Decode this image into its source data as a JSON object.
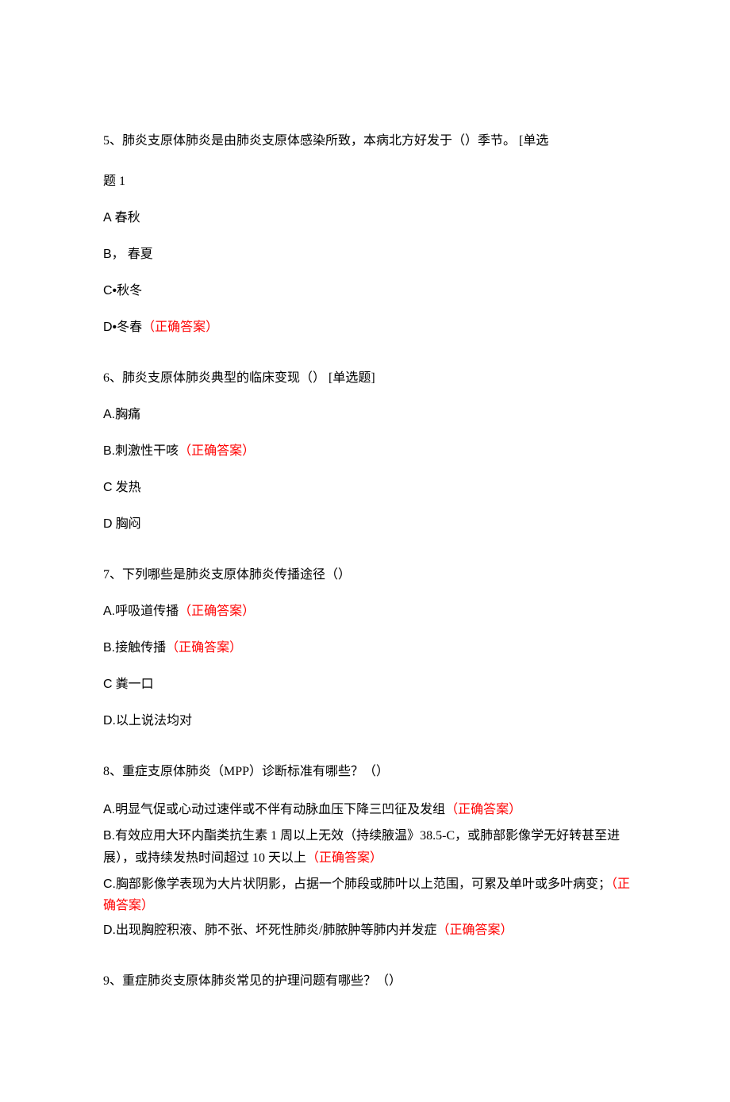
{
  "questions": [
    {
      "stem_a": "5、肺炎支原体肺炎是由肺炎支原体感染所致，本病北方好发于（）季节。 [单选",
      "stem_b": "题 1",
      "options": [
        {
          "label_prefix": "A",
          "text": "春秋",
          "correct": false
        },
        {
          "label_prefix": "B，",
          "text": "春夏",
          "correct": false
        },
        {
          "label_prefix": "C•",
          "text": "秋冬",
          "correct": false
        },
        {
          "label_prefix": "D•",
          "text": "冬春",
          "correct": true,
          "correct_label": "（正确答案）"
        }
      ]
    },
    {
      "stem_a": "6、肺炎支原体肺炎典型的临床变现（） [单选题]",
      "options": [
        {
          "label_prefix": "A.",
          "text": "胸痛",
          "correct": false
        },
        {
          "label_prefix": "B.",
          "text": "刺激性干咳",
          "correct": true,
          "correct_label": "（正确答案）"
        },
        {
          "label_prefix": "C",
          "text": "发热",
          "correct": false
        },
        {
          "label_prefix": "D",
          "text": "胸闷",
          "correct": false
        }
      ]
    },
    {
      "stem_a": "7、下列哪些是肺炎支原体肺炎传播途径（）",
      "options": [
        {
          "label_prefix": "A.",
          "text": "呼吸道传播",
          "correct": true,
          "correct_label_pre": "（正确",
          "correct_label_post": "答案）"
        },
        {
          "label_prefix": "B.",
          "text": "接触传播",
          "correct": true,
          "correct_label_pre": "（正确",
          "correct_label_post": "答案）"
        },
        {
          "label_prefix": "C",
          "text": "粪一口",
          "correct": false
        },
        {
          "label_prefix": "D.",
          "text": "以上说法均对",
          "correct": false
        }
      ]
    },
    {
      "stem_a": "8、重症支原体肺炎（MPP）诊断标准有哪些？（）",
      "options_tight": true,
      "options": [
        {
          "label_prefix": "A.",
          "text": "明显气促或心动过速伴或不伴有动脉血压下降三凹征及发组",
          "correct": true,
          "correct_label": "（正确答案）"
        },
        {
          "label_prefix": "B.",
          "text_a": "有效应用大环内酯类抗生素 1 周以上无效（持续腋温》38.5-C，或肺部影像学无好转甚至进展），或持续发热时间超过 10 天以上",
          "correct": true,
          "correct_label_pre": "（正确",
          "correct_label_post": "答案）"
        },
        {
          "label_prefix": "C.",
          "text_a": "胸部影像学表现为大片状阴影，占据一个肺段或肺叶以上范围，可累及单叶或多叶病变；",
          "correct": true,
          "correct_label": "（正确答案）"
        },
        {
          "label_prefix": "D.",
          "text": "出现胸腔积液、肺不张、坏死性肺炎/肺脓肿等肺内并发症",
          "correct": true,
          "correct_label_pre": "（正确",
          "correct_label_post": "答案）"
        }
      ]
    },
    {
      "stem_a": "9、重症肺炎支原体肺炎常见的护理问题有哪些？（）"
    }
  ]
}
